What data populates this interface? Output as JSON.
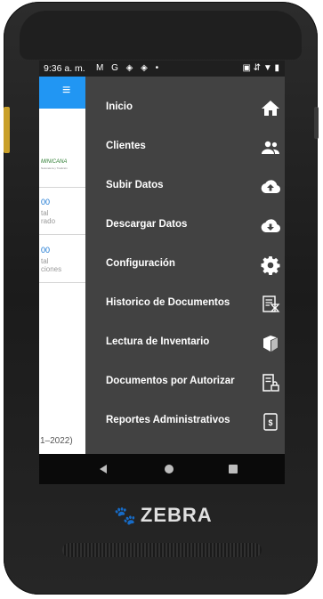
{
  "statusbar": {
    "time": "9:36 a. m.",
    "icons": "M G ◈ ◈ •",
    "right": "▣ ⇵ ▼ ▮"
  },
  "background_app": {
    "menu_icon": "≡",
    "logo_text": "MINICANA",
    "logo_subtext": "Naturaleza y Tradición",
    "card1": {
      "number": "00",
      "line1": "tal",
      "line2": "rado"
    },
    "card2": {
      "number": "00",
      "line1": "tal",
      "line2": "ciones"
    },
    "year_text": "1–2022)"
  },
  "drawer": {
    "items": [
      {
        "label": "Inicio",
        "icon": "home-icon"
      },
      {
        "label": "Clientes",
        "icon": "people-icon"
      },
      {
        "label": "Subir Datos",
        "icon": "cloud-upload-icon"
      },
      {
        "label": "Descargar Datos",
        "icon": "cloud-download-icon"
      },
      {
        "label": "Configuración",
        "icon": "gear-icon"
      },
      {
        "label": "Historico de Documentos",
        "icon": "document-history-icon"
      },
      {
        "label": "Lectura de Inventario",
        "icon": "box-icon"
      },
      {
        "label": "Documentos por Autorizar",
        "icon": "document-lock-icon"
      },
      {
        "label": "Reportes Administrativos",
        "icon": "dollar-document-icon"
      }
    ]
  },
  "device": {
    "brand": "ZEBRA",
    "brand_mark": "🐾"
  },
  "colors": {
    "drawer_bg": "#424242",
    "appbar_blue": "#2196f3",
    "navbar": "#0a0a0a"
  }
}
